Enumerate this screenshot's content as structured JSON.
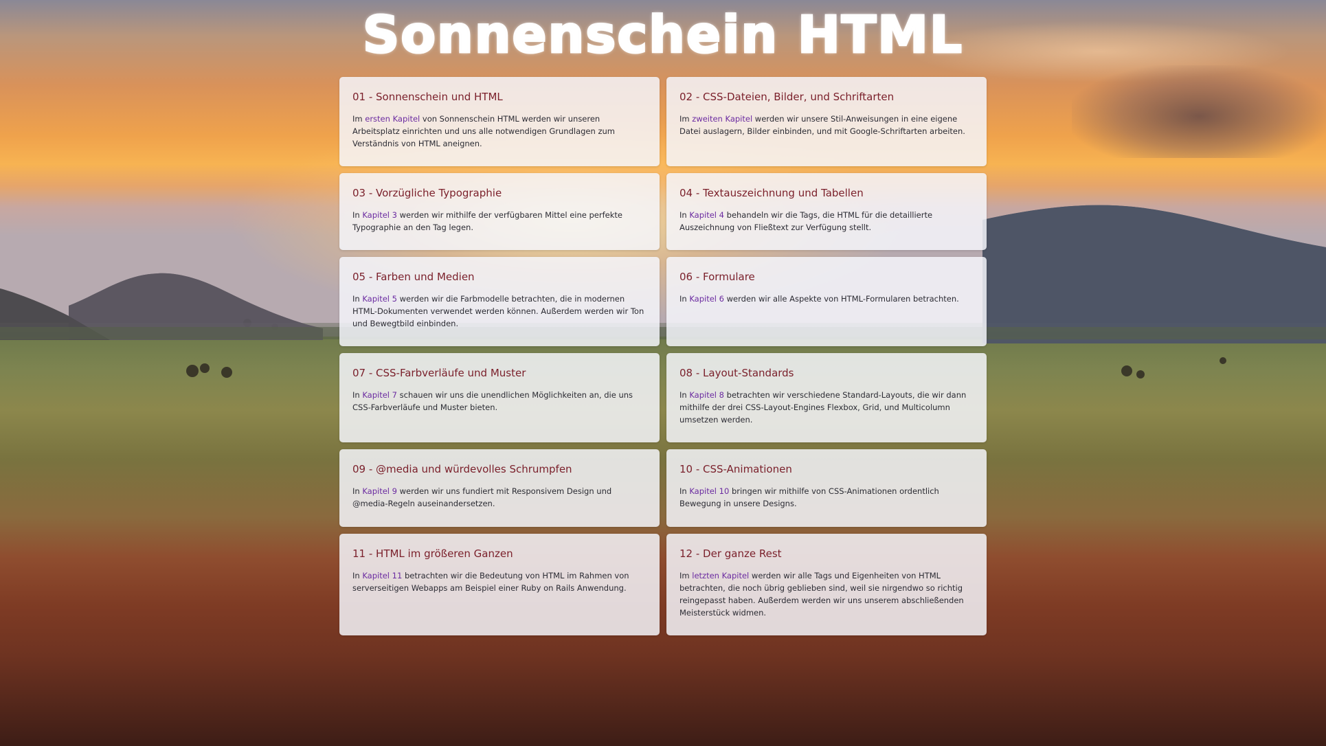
{
  "site": {
    "title": "Sonnenschein HTML"
  },
  "chapters": [
    {
      "title": "01 - Sonnenschein und HTML",
      "pre": "Im ",
      "link": "ersten Kapitel",
      "post": " von Sonnenschein HTML werden wir unseren Arbeitsplatz einrichten und uns alle notwendigen Grundlagen zum Verständnis von HTML aneignen."
    },
    {
      "title": "02 - CSS-Dateien, Bilder, und Schriftarten",
      "pre": "Im ",
      "link": "zweiten Kapitel",
      "post": " werden wir unsere Stil-Anweisungen in eine eigene Datei auslagern, Bilder einbinden, und mit Google-Schriftarten arbeiten."
    },
    {
      "title": "03 - Vorzügliche Typographie",
      "pre": "In ",
      "link": "Kapitel 3",
      "post": " werden wir mithilfe der verfügbaren Mittel eine perfekte Typographie an den Tag legen."
    },
    {
      "title": "04 - Textauszeichnung und Tabellen",
      "pre": "In ",
      "link": "Kapitel 4",
      "post": " behandeln wir die Tags, die HTML für die detaillierte Auszeichnung von Fließtext zur Verfügung stellt."
    },
    {
      "title": "05 - Farben und Medien",
      "pre": "In ",
      "link": "Kapitel 5",
      "post": " werden wir die Farbmodelle betrachten, die in modernen HTML-Dokumenten verwendet werden können. Außerdem werden wir Ton und Bewegtbild einbinden."
    },
    {
      "title": "06 - Formulare",
      "pre": "In ",
      "link": "Kapitel 6",
      "post": " werden wir alle Aspekte von HTML-Formularen betrachten."
    },
    {
      "title": "07 - CSS-Farbverläufe und Muster",
      "pre": "In ",
      "link": "Kapitel 7",
      "post": " schauen wir uns die unendlichen Möglichkeiten an, die uns CSS-Farbverläufe und Muster bieten."
    },
    {
      "title": "08 - Layout-Standards",
      "pre": "In ",
      "link": "Kapitel 8",
      "post": " betrachten wir verschiedene Standard-Layouts, die wir dann mithilfe der drei CSS-Layout-Engines Flexbox, Grid, und Multicolumn umsetzen werden."
    },
    {
      "title": "09 - @media und würdevolles Schrumpfen",
      "pre": "In ",
      "link": "Kapitel 9",
      "post": " werden wir uns fundiert mit Responsivem Design und @media-Regeln auseinandersetzen."
    },
    {
      "title": "10 - CSS-Animationen",
      "pre": "In ",
      "link": "Kapitel 10",
      "post": " bringen wir mithilfe von CSS-Animationen ordentlich Bewegung in unsere Designs."
    },
    {
      "title": "11 - HTML im größeren Ganzen",
      "pre": "In ",
      "link": "Kapitel 11",
      "post": " betrachten wir die Bedeutung von HTML im Rahmen von serverseitigen Webapps am Beispiel einer Ruby on Rails Anwendung."
    },
    {
      "title": "12 - Der ganze Rest",
      "pre": "Im ",
      "link": "letzten Kapitel",
      "post": " werden wir alle Tags und Eigenheiten von HTML betrachten, die noch übrig geblieben sind, weil sie nirgendwo so richtig reingepasst haben. Außerdem werden wir uns unserem abschließenden Meisterstück widmen."
    }
  ]
}
